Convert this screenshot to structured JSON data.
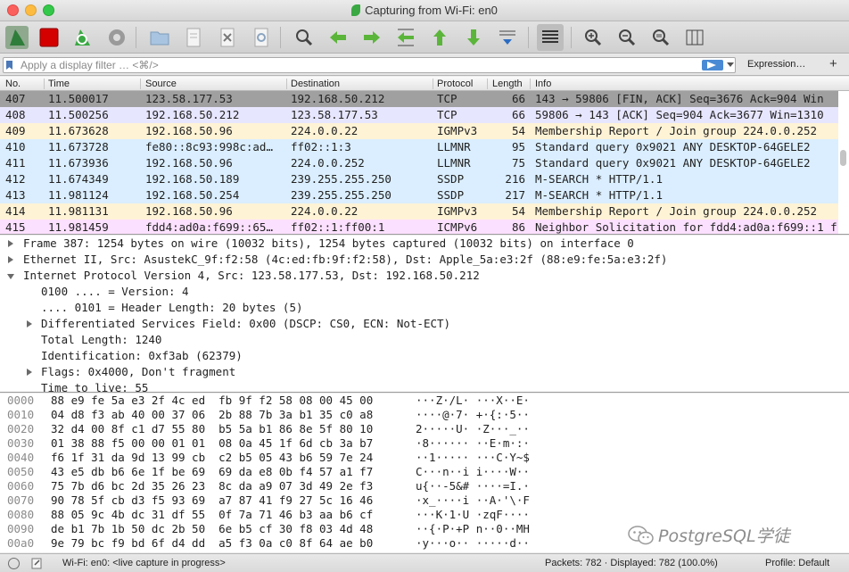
{
  "window": {
    "title": "Capturing from Wi-Fi: en0"
  },
  "toolbar": {
    "buttons": [
      "start-capture",
      "stop-capture",
      "restart-capture",
      "capture-options",
      "open-file",
      "save-file",
      "close-file",
      "reload-file",
      "find-packet",
      "go-back",
      "go-forward",
      "go-to-packet",
      "go-first",
      "go-last",
      "auto-scroll",
      "colorize",
      "zoom-in",
      "zoom-out",
      "zoom-normal",
      "resize-columns"
    ]
  },
  "filter": {
    "placeholder": "Apply a display filter … <⌘/>",
    "expression_label": "Expression…",
    "add_label": "+"
  },
  "packet_list": {
    "columns": [
      "No.",
      "Time",
      "Source",
      "Destination",
      "Protocol",
      "Length",
      "Info"
    ],
    "rows": [
      {
        "no": "407",
        "time": "11.500017",
        "source": "123.58.177.53",
        "destination": "192.168.50.212",
        "protocol": "TCP",
        "length": "66",
        "info": "143 → 59806 [FIN, ACK] Seq=3676 Ack=904 Win"
      },
      {
        "no": "408",
        "time": "11.500256",
        "source": "192.168.50.212",
        "destination": "123.58.177.53",
        "protocol": "TCP",
        "length": "66",
        "info": "59806 → 143 [ACK] Seq=904 Ack=3677 Win=1310"
      },
      {
        "no": "409",
        "time": "11.673628",
        "source": "192.168.50.96",
        "destination": "224.0.0.22",
        "protocol": "IGMPv3",
        "length": "54",
        "info": "Membership Report / Join group 224.0.0.252"
      },
      {
        "no": "410",
        "time": "11.673728",
        "source": "fe80::8c93:998c:ad…",
        "destination": "ff02::1:3",
        "protocol": "LLMNR",
        "length": "95",
        "info": "Standard query 0x9021 ANY DESKTOP-64GELE2"
      },
      {
        "no": "411",
        "time": "11.673936",
        "source": "192.168.50.96",
        "destination": "224.0.0.252",
        "protocol": "LLMNR",
        "length": "75",
        "info": "Standard query 0x9021 ANY DESKTOP-64GELE2"
      },
      {
        "no": "412",
        "time": "11.674349",
        "source": "192.168.50.189",
        "destination": "239.255.255.250",
        "protocol": "SSDP",
        "length": "216",
        "info": "M-SEARCH * HTTP/1.1"
      },
      {
        "no": "413",
        "time": "11.981124",
        "source": "192.168.50.254",
        "destination": "239.255.255.250",
        "protocol": "SSDP",
        "length": "217",
        "info": "M-SEARCH * HTTP/1.1"
      },
      {
        "no": "414",
        "time": "11.981131",
        "source": "192.168.50.96",
        "destination": "224.0.0.22",
        "protocol": "IGMPv3",
        "length": "54",
        "info": "Membership Report / Join group 224.0.0.252"
      },
      {
        "no": "415",
        "time": "11.981459",
        "source": "fdd4:ad0a:f699::65…",
        "destination": "ff02::1:ff00:1",
        "protocol": "ICMPv6",
        "length": "86",
        "info": "Neighbor Solicitation for fdd4:ad0a:f699::1 f"
      }
    ]
  },
  "details": {
    "rows": [
      {
        "text": "Frame 387: 1254 bytes on wire (10032 bits), 1254 bytes captured (10032 bits) on interface 0",
        "toggle": "collapsed"
      },
      {
        "text": "Ethernet II, Src: AsustekC_9f:f2:58 (4c:ed:fb:9f:f2:58), Dst: Apple_5a:e3:2f (88:e9:fe:5a:e3:2f)",
        "toggle": "collapsed"
      },
      {
        "text": "Internet Protocol Version 4, Src: 123.58.177.53, Dst: 192.168.50.212",
        "toggle": "expanded"
      },
      {
        "text": "0100 .... = Version: 4",
        "toggle": "none"
      },
      {
        "text": ".... 0101 = Header Length: 20 bytes (5)",
        "toggle": "none"
      },
      {
        "text": "Differentiated Services Field: 0x00 (DSCP: CS0, ECN: Not-ECT)",
        "toggle": "collapsed"
      },
      {
        "text": "Total Length: 1240",
        "toggle": "none"
      },
      {
        "text": "Identification: 0xf3ab (62379)",
        "toggle": "none"
      },
      {
        "text": "Flags: 0x4000, Don't fragment",
        "toggle": "collapsed"
      },
      {
        "text": "Time to live: 55",
        "toggle": "none"
      }
    ]
  },
  "bytes": {
    "rows": [
      {
        "offset": "0000",
        "hex": "88 e9 fe 5a e3 2f 4c ed  fb 9f f2 58 08 00 45 00",
        "ascii": "···Z·/L· ···X··E·"
      },
      {
        "offset": "0010",
        "hex": "04 d8 f3 ab 40 00 37 06  2b 88 7b 3a b1 35 c0 a8",
        "ascii": "····@·7· +·{:·5··"
      },
      {
        "offset": "0020",
        "hex": "32 d4 00 8f c1 d7 55 80  b5 5a b1 86 8e 5f 80 10",
        "ascii": "2·····U· ·Z···_··"
      },
      {
        "offset": "0030",
        "hex": "01 38 88 f5 00 00 01 01  08 0a 45 1f 6d cb 3a b7",
        "ascii": "·8······ ··E·m·:·"
      },
      {
        "offset": "0040",
        "hex": "f6 1f 31 da 9d 13 99 cb  c2 b5 05 43 b6 59 7e 24",
        "ascii": "··1····· ···C·Y~$"
      },
      {
        "offset": "0050",
        "hex": "43 e5 db b6 6e 1f be 69  69 da e8 0b f4 57 a1 f7",
        "ascii": "C···n··i i····W··"
      },
      {
        "offset": "0060",
        "hex": "75 7b d6 bc 2d 35 26 23  8c da a9 07 3d 49 2e f3",
        "ascii": "u{··-5&# ····=I.·"
      },
      {
        "offset": "0070",
        "hex": "90 78 5f cb d3 f5 93 69  a7 87 41 f9 27 5c 16 46",
        "ascii": "·x_····i ··A·'\\·F"
      },
      {
        "offset": "0080",
        "hex": "88 05 9c 4b dc 31 df 55  0f 7a 71 46 b3 aa b6 cf",
        "ascii": "···K·1·U ·zqF····"
      },
      {
        "offset": "0090",
        "hex": "de b1 7b 1b 50 dc 2b 50  6e b5 cf 30 f8 03 4d 48",
        "ascii": "··{·P·+P n··0··MH"
      },
      {
        "offset": "00a0",
        "hex": "9e 79 bc f9 bd 6f d4 dd  a5 f3 0a c0 8f 64 ae b0",
        "ascii": "·y···o·· ·····d··"
      }
    ],
    "watermark": "PostgreSQL学徒"
  },
  "status": {
    "interface": "Wi-Fi: en0: <live capture in progress>",
    "packets": "Packets: 782 · Displayed: 782 (100.0%)",
    "profile": "Profile: Default"
  },
  "colors": {
    "tcp_dark": "#a0a0a0",
    "tcp": "#e7e6ff",
    "igmp": "#fff3d6",
    "udp": "#daeeff",
    "icmpv6": "#fce0ff"
  }
}
